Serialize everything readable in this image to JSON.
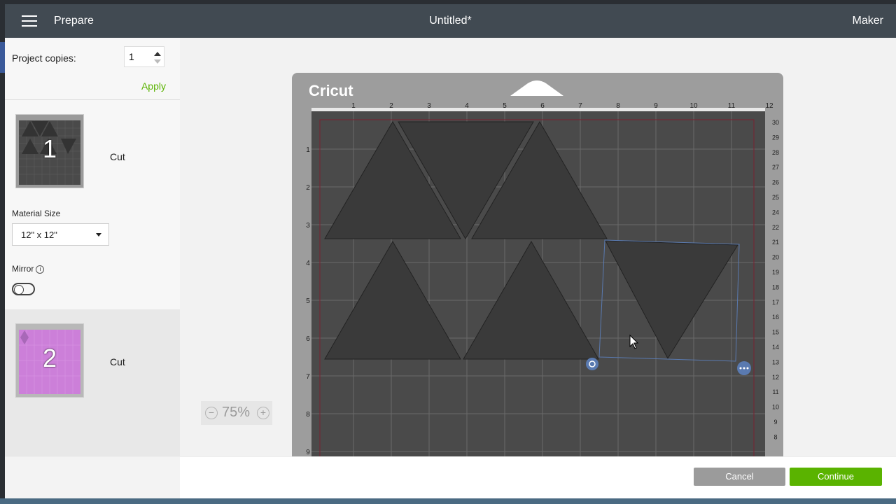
{
  "topbar": {
    "screen": "Prepare",
    "title": "Untitled*",
    "machine": "Maker"
  },
  "sidebar": {
    "copies_label": "Project copies:",
    "copies_value": "1",
    "apply_label": "Apply",
    "mats": [
      {
        "number": "1",
        "action": "Cut",
        "brand": "Cricut"
      },
      {
        "number": "2",
        "action": "Cut",
        "brand": "Cricut"
      }
    ],
    "material_size_label": "Material Size",
    "material_size_value": "12\" x 12\"",
    "mirror_label": "Mirror",
    "mirror_on": false
  },
  "mat": {
    "brand": "Cricut",
    "top_ruler": [
      "1",
      "2",
      "3",
      "4",
      "5",
      "6",
      "7",
      "8",
      "9",
      "10",
      "11",
      "12"
    ],
    "left_ruler": [
      "1",
      "2",
      "3",
      "4",
      "5",
      "6",
      "7",
      "8",
      "9"
    ],
    "right_ruler": [
      "30",
      "29",
      "28",
      "27",
      "26",
      "25",
      "24",
      "22",
      "21",
      "20",
      "19",
      "18",
      "17",
      "16",
      "15",
      "14",
      "13",
      "12",
      "11",
      "10",
      "9",
      "8"
    ]
  },
  "zoom": {
    "value": "75%",
    "minus": "−",
    "plus": "+"
  },
  "footer": {
    "cancel": "Cancel",
    "continue": "Continue"
  },
  "colors": {
    "accent": "#5ab300",
    "topbar": "#414a52",
    "mat": "#4a4a4a",
    "shape": "#3a3a3a",
    "mat2": "#cc7fd9"
  },
  "icons": {
    "menu": "hamburger-icon",
    "rotate": "rotate-icon",
    "more": "more-icon",
    "info": "info-icon"
  }
}
